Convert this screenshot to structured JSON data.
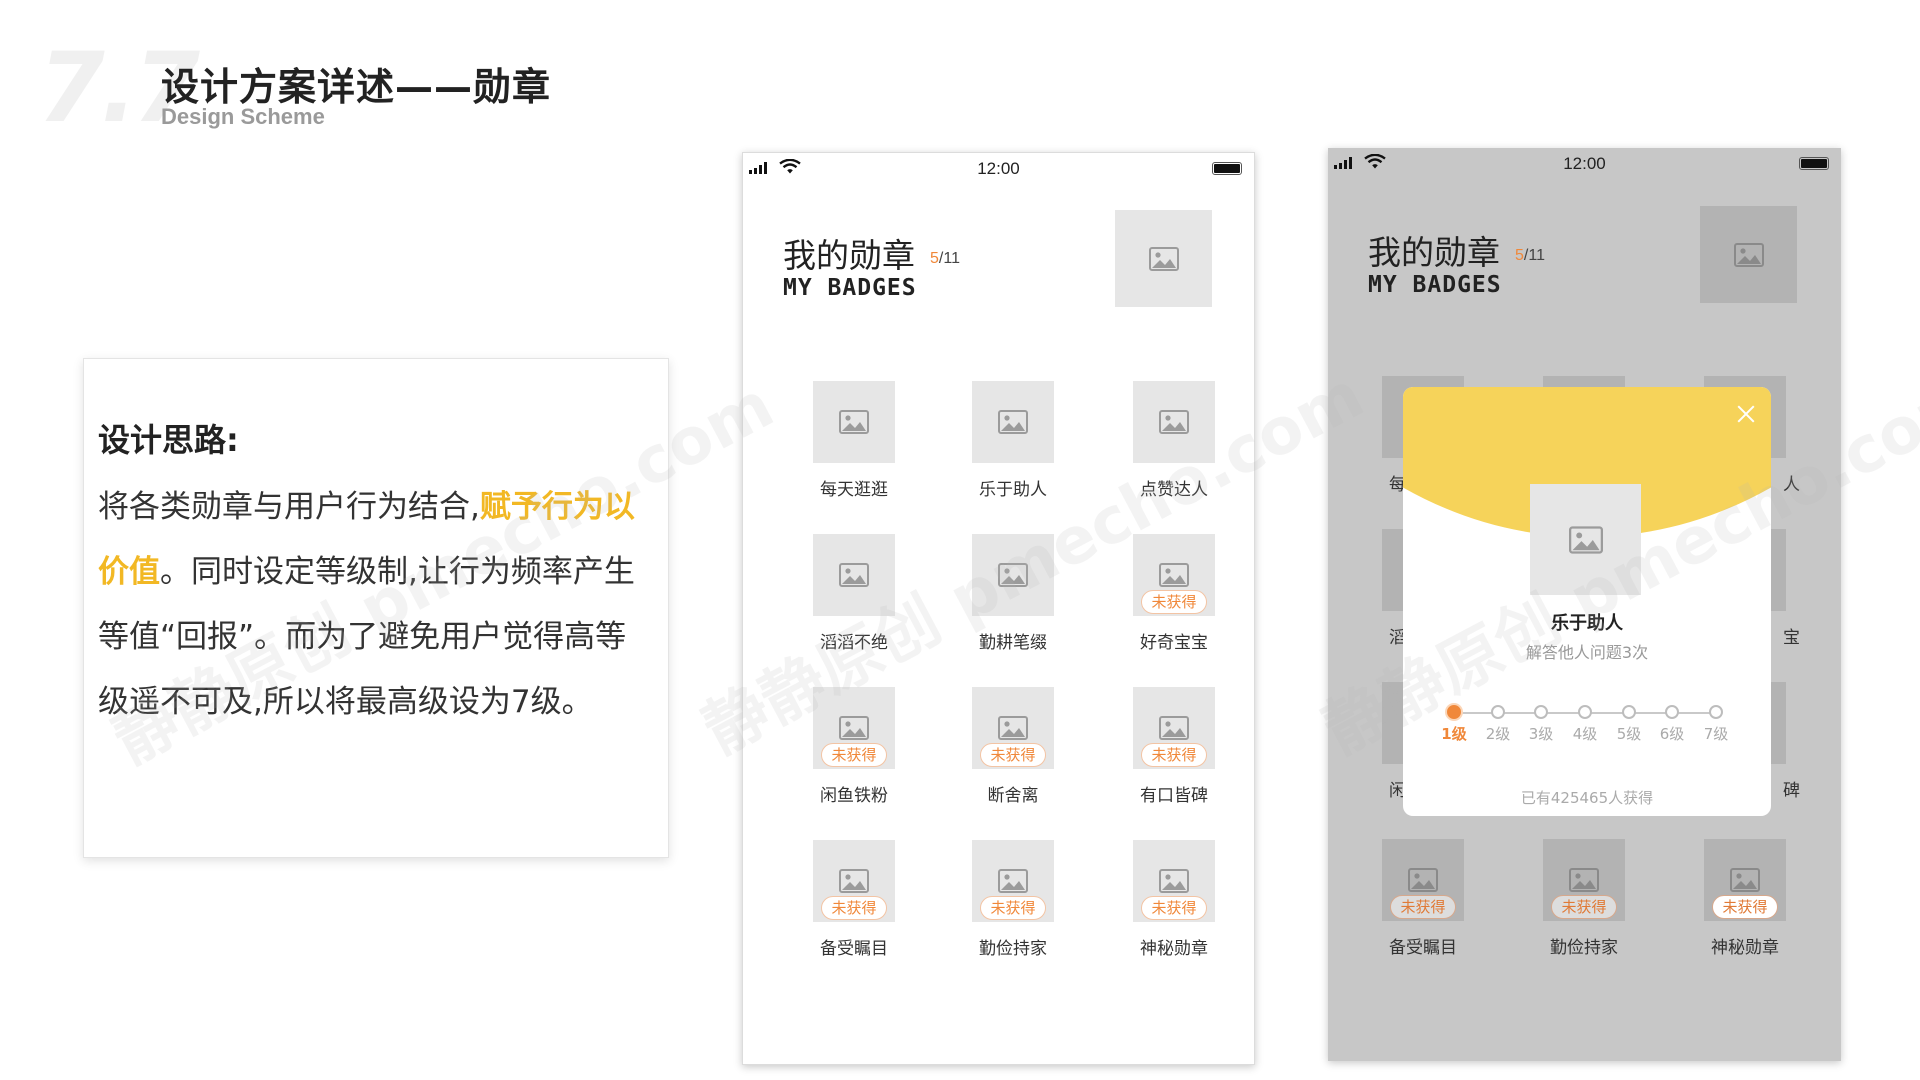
{
  "header": {
    "number": "7.7",
    "title": "设计方案详述——勋章",
    "subtitle": "Design Scheme"
  },
  "note": {
    "title": "设计思路:",
    "text_before": "将各类勋章与用户行为结合,",
    "highlight": "赋予行为以价值",
    "text_after": "。同时设定等级制,让行为频率产生等值“回报”。而为了避免用户觉得高等级遥不可及,所以将最高级设为7级。"
  },
  "watermark": "静静原创 pmecho.com",
  "colors": {
    "accent_yellow": "#f2b824",
    "accent_orange": "#f0883a",
    "modal_banner": "#f6d35a",
    "placeholder_gray": "#e6e6e6",
    "overlay_gray": "#c7c7c7"
  },
  "phone1": {
    "time": "12:00",
    "title": "我的勋章",
    "count_obtained": "5",
    "count_total": "/11",
    "subtitle": "MY BADGES",
    "not_obtained_label": "未获得",
    "badges": [
      {
        "name": "每天逛逛",
        "obtained": true
      },
      {
        "name": "乐于助人",
        "obtained": true
      },
      {
        "name": "点赞达人",
        "obtained": true
      },
      {
        "name": "滔滔不绝",
        "obtained": true
      },
      {
        "name": "勤耕笔缀",
        "obtained": true
      },
      {
        "name": "好奇宝宝",
        "obtained": false
      },
      {
        "name": "闲鱼铁粉",
        "obtained": false
      },
      {
        "name": "断舍离",
        "obtained": false
      },
      {
        "name": "有口皆碑",
        "obtained": false
      },
      {
        "name": "备受瞩目",
        "obtained": false
      },
      {
        "name": "勤俭持家",
        "obtained": false
      },
      {
        "name": "神秘勋章",
        "obtained": false
      }
    ]
  },
  "phone2": {
    "time": "12:00",
    "title": "我的勋章",
    "count_obtained": "5",
    "count_total": "/11",
    "subtitle": "MY BADGES",
    "bg_fragments": [
      "每",
      "人",
      "滔",
      "宝",
      "闲",
      "碑"
    ],
    "bottom_badges": [
      {
        "name": "备受瞩目",
        "tag": "未获得"
      },
      {
        "name": "勤俭持家",
        "tag": "未获得"
      },
      {
        "name": "神秘勋章",
        "tag": "未获得"
      }
    ],
    "modal": {
      "badge_name": "乐于助人",
      "description": "解答他人问题3次",
      "current_level": 1,
      "levels": [
        "1级",
        "2级",
        "3级",
        "4级",
        "5级",
        "6级",
        "7级"
      ],
      "footer": "已有425465人获得"
    }
  }
}
